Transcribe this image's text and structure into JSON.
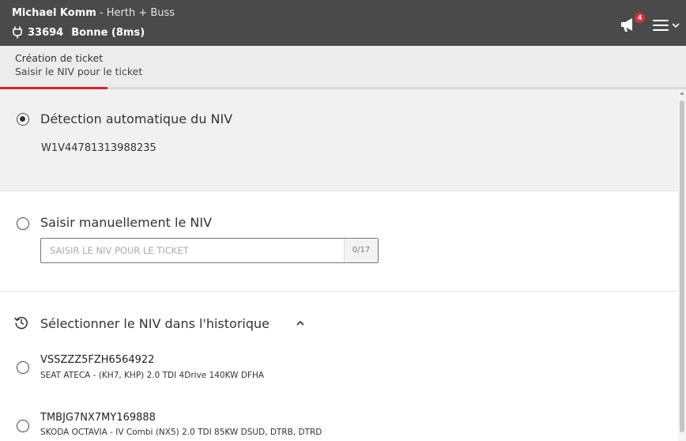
{
  "topbar": {
    "user_name": "Michael Komm",
    "company": " - Herth + Buss",
    "connection_id": "33694",
    "connection_status": "Bonne (8ms)",
    "notification_count": "4",
    "icons": [
      "plug-icon",
      "megaphone-icon",
      "hamburger-menu-icon",
      "chevron-down-icon"
    ]
  },
  "subheader": {
    "title": "Création de ticket",
    "subtitle": "Saisir le NIV pour le ticket",
    "progress_fraction": 0.157,
    "progress_color": "#d8232a"
  },
  "options": {
    "auto": {
      "label": "Détection automatique du NIV",
      "value": "W1V44781313988235",
      "selected": true
    },
    "manual": {
      "label": "Saisir manuellement le NIV",
      "placeholder": "SAISIR LE NIV POUR LE TICKET",
      "value": "",
      "counter": "0/17",
      "selected": false
    },
    "history": {
      "title": "Sélectionner le NIV dans l'historique",
      "expanded": true,
      "items": [
        {
          "vin": "VSSZZZ5FZH6564922",
          "description": "SEAT ATECA - (KH7, KHP) 2.0 TDI 4Drive 140KW DFHA"
        },
        {
          "vin": "TMBJG7NX7MY169888",
          "description": "SKODA OCTAVIA - IV Combi (NX5) 2.0 TDI 85KW DSUD, DTRB, DTRD"
        }
      ]
    }
  }
}
